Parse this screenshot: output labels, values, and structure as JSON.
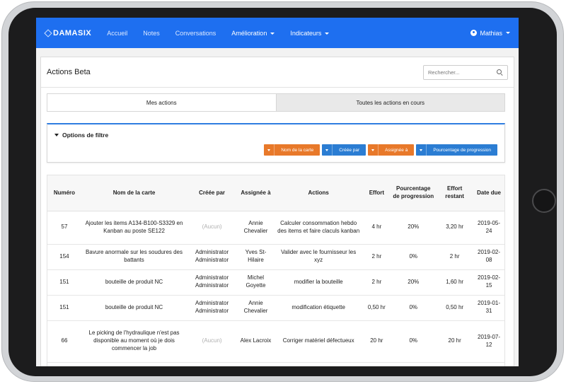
{
  "navbar": {
    "brand": "DAMASIX",
    "links": [
      "Accueil",
      "Notes",
      "Conversations"
    ],
    "dropdowns": [
      "Amélioration",
      "Indicateurs"
    ],
    "user": "Mathias"
  },
  "header": {
    "title": "Actions Beta",
    "search_placeholder": "Rechercher..."
  },
  "tabs": [
    "Mes actions",
    "Toutes les actions en cours"
  ],
  "filter": {
    "title": "Options de filtre",
    "buttons": [
      {
        "label": "Nom de la carte",
        "color": "#e8792a"
      },
      {
        "label": "Créée par",
        "color": "#2b7dd3"
      },
      {
        "label": "Assignée à",
        "color": "#e8792a"
      },
      {
        "label": "Pourcentage de progression",
        "color": "#2b7dd3"
      }
    ]
  },
  "table": {
    "headers": [
      "Numéro",
      "Nom de la carte",
      "Créée par",
      "Assignée à",
      "Actions",
      "Effort",
      "Pourcentage de progression",
      "Effort restant",
      "Date due"
    ],
    "rows": [
      {
        "numero": "57",
        "nom": "Ajouter les items A134-B100-S3329 en Kanban au poste SE122",
        "creee": "(Aucun)",
        "assignee": "Annie Chevalier",
        "action": "Calculer consommation hebdo des items et faire claculs kanban",
        "effort": "4 hr",
        "pourcentage": "20%",
        "restant": "3,20 hr",
        "date": "2019-05-24"
      },
      {
        "numero": "154",
        "nom": "Bavure anormale sur les soudures des battants",
        "creee": "Administrator Administrator",
        "assignee": "Yves St-Hilaire",
        "action": "Valider avec le fournisseur les xyz",
        "effort": "2 hr",
        "pourcentage": "0%",
        "restant": "2 hr",
        "date": "2019-02-08"
      },
      {
        "numero": "151",
        "nom": "bouteille de produit NC",
        "creee": "Administrator Administrator",
        "assignee": "Michel Goyette",
        "action": "modifier la bouteille",
        "effort": "2 hr",
        "pourcentage": "20%",
        "restant": "1,60 hr",
        "date": "2019-02-15"
      },
      {
        "numero": "151",
        "nom": "bouteille de produit NC",
        "creee": "Administrator Administrator",
        "assignee": "Annie Chevalier",
        "action": "modification étiquette",
        "effort": "0,50 hr",
        "pourcentage": "0%",
        "restant": "0,50 hr",
        "date": "2019-01-31"
      },
      {
        "numero": "66",
        "nom": "Le picking de l'hydraulique n'est pas disponible au moment où je dois commencer la job",
        "creee": "(Aucun)",
        "assignee": "Alex Lacroix",
        "action": "Corriger matériel défectueux",
        "effort": "20 hr",
        "pourcentage": "0%",
        "restant": "20 hr",
        "date": "2019-07-12"
      }
    ]
  }
}
